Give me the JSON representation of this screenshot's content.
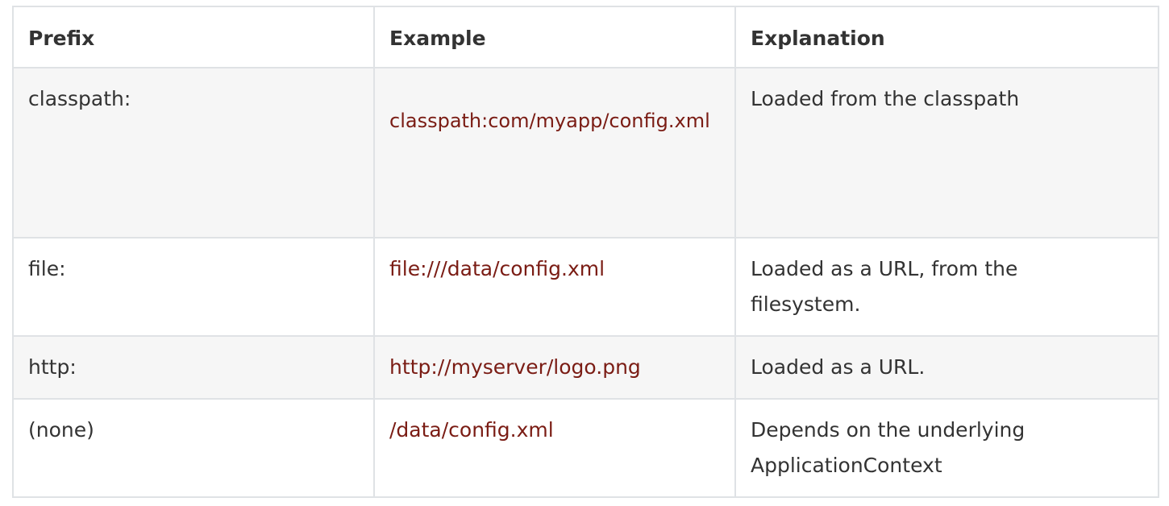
{
  "table": {
    "headers": [
      "Prefix",
      "Example",
      "Explanation"
    ],
    "rows": [
      {
        "prefix": "classpath:",
        "example": "classpath:com/myapp/config.xml",
        "explanation": "Loaded from the classpath"
      },
      {
        "prefix": "file:",
        "example": "file:///data/config.xml",
        "explanation": "Loaded as a URL, from the filesystem."
      },
      {
        "prefix": "http:",
        "example": "http://myserver/logo.png",
        "explanation": "Loaded as a URL."
      },
      {
        "prefix": "(none)",
        "example": "/data/config.xml",
        "explanation": "Depends on the underlying ApplicationContext"
      }
    ]
  },
  "colors": {
    "code_text": "#7a1c14",
    "border": "#dfe2e5",
    "shaded_row": "#f6f6f6",
    "text": "#333333"
  }
}
